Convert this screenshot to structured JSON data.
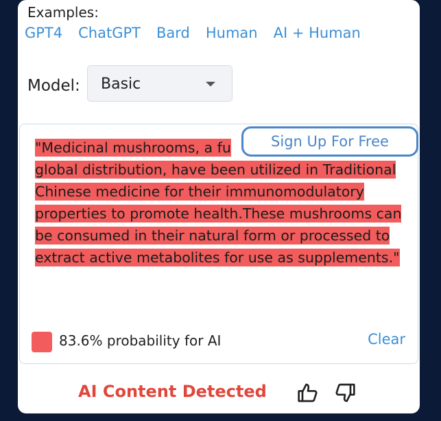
{
  "examples": {
    "label": "Examples:",
    "links": [
      "GPT4",
      "ChatGPT",
      "Bard",
      "Human",
      "AI + Human"
    ]
  },
  "model": {
    "label": "Model:",
    "selected": "Basic"
  },
  "input": {
    "text_before": "\"Medicinal mushrooms, a fu",
    "text_after": "global distribution, have been utilized in Traditional Chinese medicine for their immunomodulatory properties to promote health.These mushrooms can be consumed in their natural form or processed to extract active metabolites for use as supplements.\""
  },
  "signup": {
    "label": "Sign Up For Free"
  },
  "result": {
    "probability_text": "83.6% probability for AI",
    "probability": 0.836,
    "clear_label": "Clear",
    "verdict": "AI Content Detected",
    "highlight_color": "#f25c5c"
  },
  "icons": {
    "thumbs_up": "thumbs-up-icon",
    "thumbs_down": "thumbs-down-icon"
  }
}
